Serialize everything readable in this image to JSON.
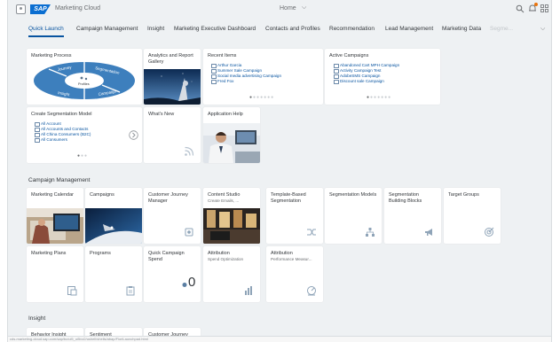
{
  "shell": {
    "app_title": "Marketing Cloud",
    "logo_text": "SAP",
    "home_label": "Home",
    "home_chevron": "⌵",
    "icons": {
      "search": "search-icon",
      "notifications": "bell-icon",
      "apps": "grid-icon"
    }
  },
  "tabs": [
    {
      "label": "Quick Launch",
      "active": true
    },
    {
      "label": "Campaign Management"
    },
    {
      "label": "Insight"
    },
    {
      "label": "Marketing Executive Dashboard"
    },
    {
      "label": "Contacts and Profiles"
    },
    {
      "label": "Recommendation"
    },
    {
      "label": "Lead Management"
    },
    {
      "label": "Marketing Data"
    },
    {
      "label": "Segme..."
    }
  ],
  "tabs_overflow": "⌵",
  "quick_launch": {
    "marketing_process": {
      "title": "Marketing Process",
      "segments": [
        "Journey",
        "Segmentation",
        "Campaign",
        "Insight"
      ],
      "center_label": "Profiles"
    },
    "analytics": {
      "title": "Analytics and Report Gallery"
    },
    "recent_items": {
      "title": "Recent Items",
      "items": [
        "Arthur Garcia",
        "Summer Sale Campaign",
        "Social media advertising Campaign",
        "Fred Fox"
      ]
    },
    "active_campaigns": {
      "title": "Active Campaigns",
      "items": [
        "Abandoned Cart MPH Campaign",
        "Activity Campaign Test",
        "AdobeSMS Campaign",
        "Discount sale Campaign"
      ]
    },
    "segmentation_model": {
      "title": "Create Segmentation Model",
      "items": [
        "All Account",
        "All Accounts and Contacts",
        "All China Consumers (B2C)",
        "All Consumers"
      ]
    },
    "whats_new": {
      "title": "What's New"
    },
    "application_help": {
      "title": "Application Help"
    }
  },
  "campaign_management": {
    "group_title": "Campaign Management",
    "tiles": [
      {
        "title": "Marketing Calendar",
        "sub": ""
      },
      {
        "title": "Campaigns",
        "sub": ""
      },
      {
        "title": "Customer Journey Manager",
        "sub": ""
      },
      {
        "title": "Content Studio",
        "sub": "Create Emails, ..."
      },
      {
        "title": "Template-Based Segmentation",
        "sub": ""
      },
      {
        "title": "Segmentation Models",
        "sub": ""
      },
      {
        "title": "Segmentation Building Blocks",
        "sub": ""
      },
      {
        "title": "Target Groups",
        "sub": ""
      },
      {
        "title": "Marketing Plans",
        "sub": ""
      },
      {
        "title": "Programs",
        "sub": ""
      },
      {
        "title": "Quick Campaign Spend",
        "sub": "",
        "kpi": "0"
      },
      {
        "title": "Attribution",
        "sub": "Spend Optimization"
      },
      {
        "title": "Attribution",
        "sub": "Performance Measur..."
      }
    ]
  },
  "insight": {
    "group_title": "Insight",
    "tiles": [
      {
        "title": "Behavior Insight"
      },
      {
        "title": "Sentiment"
      },
      {
        "title": "Customer Journey"
      }
    ]
  },
  "status_url": "cds-marketing-cloud.sap.com/sap/bc/ui5_ui5/ui2/ushell/shells/abap/FioriLaunchpad.html"
}
